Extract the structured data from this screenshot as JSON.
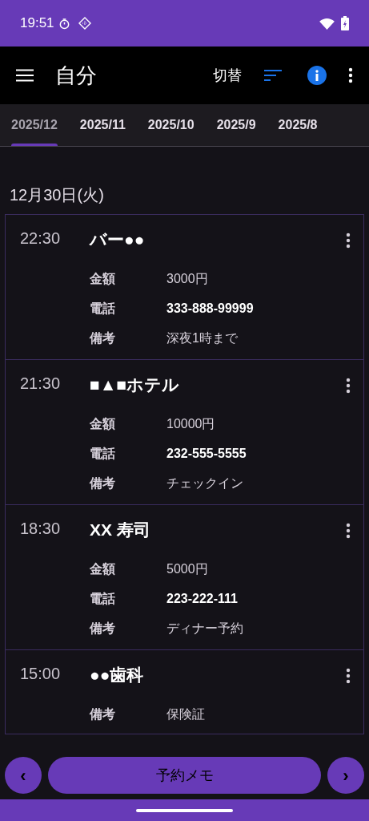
{
  "status_bar": {
    "time": "19:51"
  },
  "app_bar": {
    "title": "自分",
    "switch_label": "切替"
  },
  "tabs": [
    {
      "label": "2025/12",
      "selected": true
    },
    {
      "label": "2025/11",
      "selected": false
    },
    {
      "label": "2025/10",
      "selected": false
    },
    {
      "label": "2025/9",
      "selected": false
    },
    {
      "label": "2025/8",
      "selected": false
    }
  ],
  "date_header": "12月30日(火)",
  "entries": [
    {
      "time": "22:30",
      "title": "バー●●",
      "fields": [
        {
          "label": "金額",
          "value": "3000円",
          "bold": false
        },
        {
          "label": "電話",
          "value": "333-888-99999",
          "bold": true
        },
        {
          "label": "備考",
          "value": "深夜1時まで",
          "bold": false
        }
      ]
    },
    {
      "time": "21:30",
      "title": "■▲■ホテル",
      "fields": [
        {
          "label": "金額",
          "value": "10000円",
          "bold": false
        },
        {
          "label": "電話",
          "value": "232-555-5555",
          "bold": true
        },
        {
          "label": "備考",
          "value": "チェックイン",
          "bold": false
        }
      ]
    },
    {
      "time": "18:30",
      "title": "XX 寿司",
      "fields": [
        {
          "label": "金額",
          "value": "5000円",
          "bold": false
        },
        {
          "label": "電話",
          "value": "223-222-111",
          "bold": true
        },
        {
          "label": "備考",
          "value": "ディナー予約",
          "bold": false
        }
      ]
    },
    {
      "time": "15:00",
      "title": "●●歯科",
      "fields": [
        {
          "label": "備考",
          "value": "保険証",
          "bold": false
        }
      ]
    }
  ],
  "bottom_bar": {
    "prev": "‹",
    "center": "予約メモ",
    "next": "›"
  }
}
